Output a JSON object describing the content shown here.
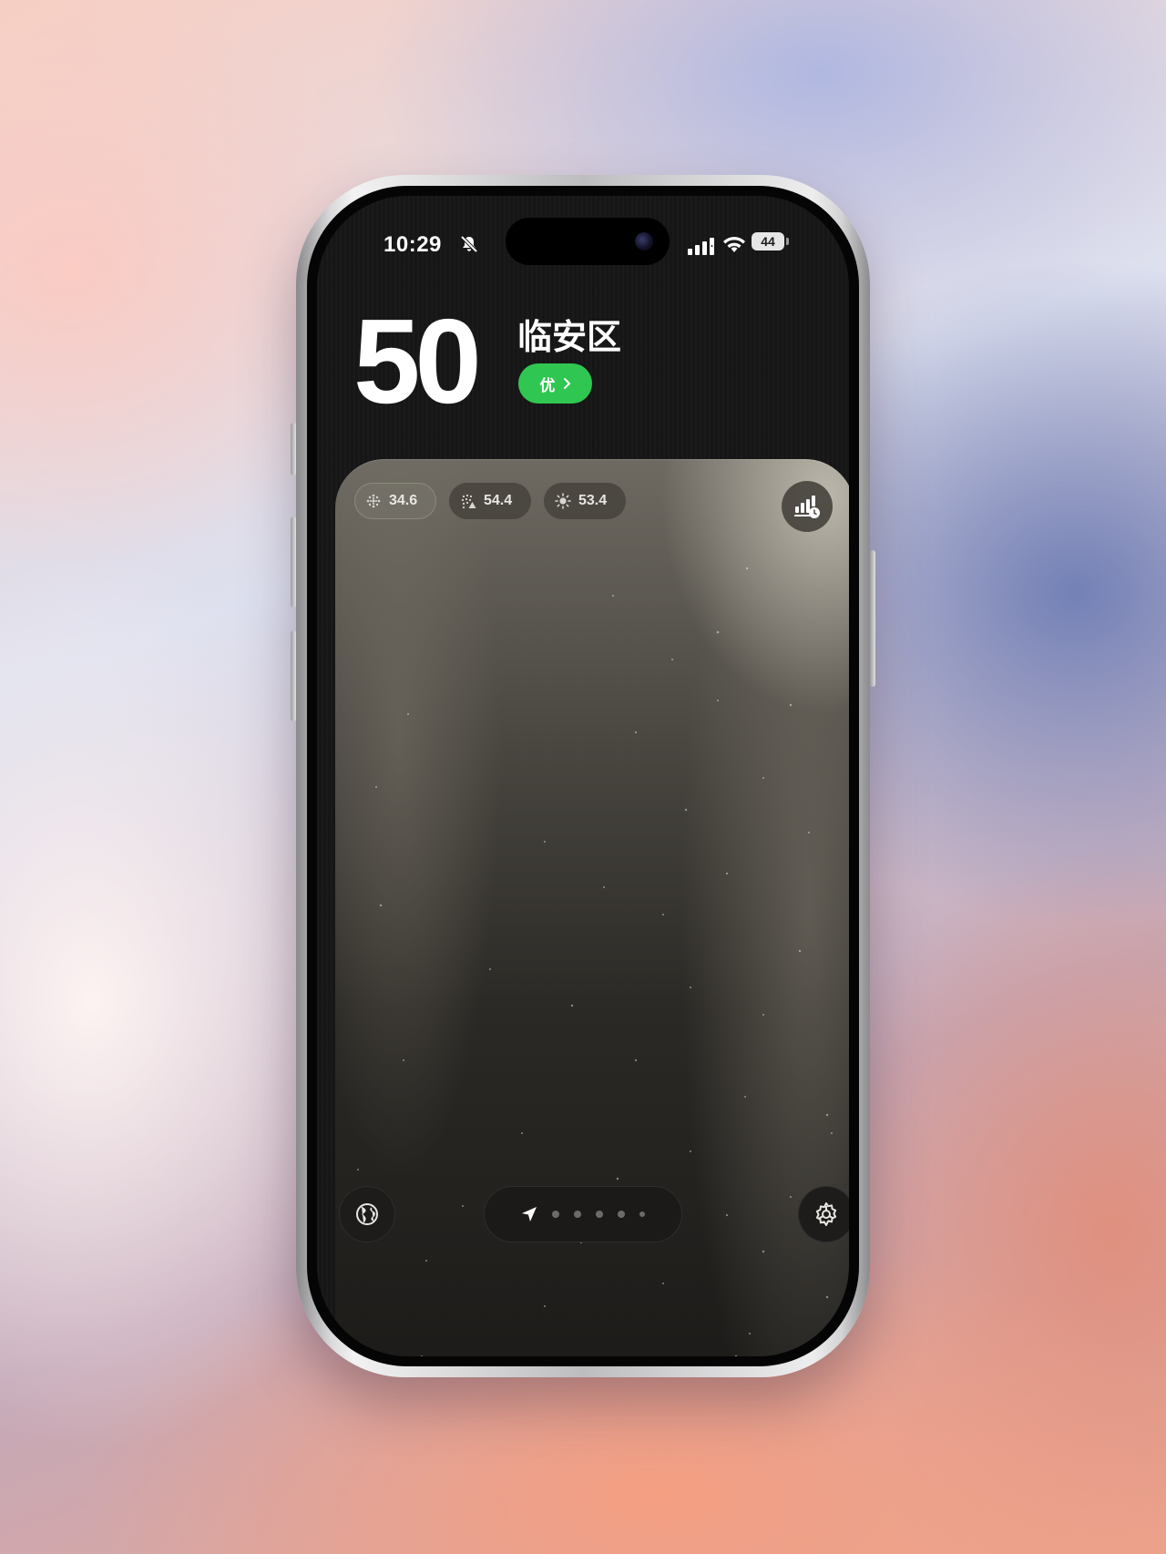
{
  "status_bar": {
    "time": "10:29",
    "battery": "44"
  },
  "header": {
    "aqi_value": "50",
    "district": "临安区",
    "grade": "优",
    "grade_color": "#2fc751"
  },
  "pollutants": [
    {
      "icon": "particles-icon",
      "value": "34.6"
    },
    {
      "icon": "particles-warning-icon",
      "value": "54.4"
    },
    {
      "icon": "sun-icon",
      "value": "53.4"
    }
  ],
  "controls": {
    "trend_icon": "bar-chart-clock-icon",
    "left_icon": "globe-icon",
    "right_icon": "settings-gear-icon",
    "page_count": 5,
    "current_page_icon": "location-arrow-icon"
  }
}
